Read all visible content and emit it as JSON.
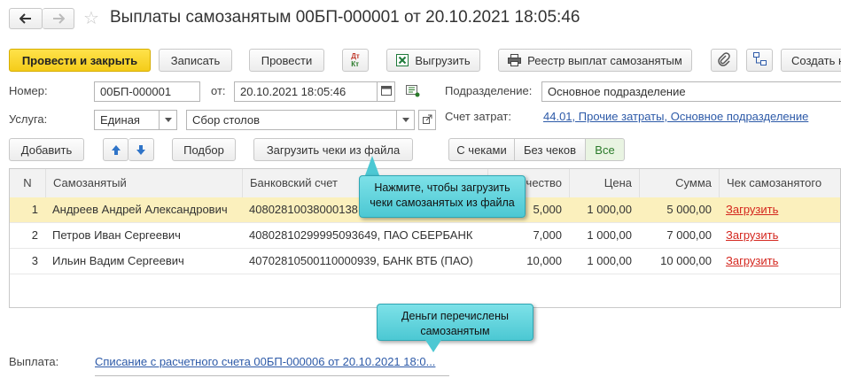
{
  "window": {
    "title": "Выплаты самозанятым 00БП-000001 от 20.10.2021 18:05:46"
  },
  "toolbar": {
    "post_close": "Провести и закрыть",
    "save": "Записать",
    "post": "Провести",
    "dt_kt_top": "Дт",
    "dt_kt_bottom": "Кт",
    "export": "Выгрузить",
    "registry": "Реестр выплат самозанятым",
    "create_on_basis": "Создать н"
  },
  "form": {
    "number_label": "Номер:",
    "number_value": "00БП-000001",
    "date_label": "от:",
    "date_value": "20.10.2021 18:05:46",
    "division_label": "Подразделение:",
    "division_value": "Основное подразделение",
    "service_label": "Услуга:",
    "service_type": "Единая",
    "service_value": "Сбор столов",
    "cost_account_label": "Счет затрат:",
    "cost_account_value": "44.01, Прочие затраты, Основное подразделение"
  },
  "table_toolbar": {
    "add": "Добавить",
    "pick": "Подбор",
    "load_receipts": "Загрузить чеки из файла",
    "filters": [
      "С чеками",
      "Без чеков",
      "Все"
    ],
    "active_filter": "Все"
  },
  "table": {
    "headers": [
      "N",
      "Самозанятый",
      "Банковский счет",
      "Количество",
      "Цена",
      "Сумма",
      "Чек самозанятого"
    ],
    "header_qty_visible": "чество",
    "rows": [
      {
        "n": "1",
        "person": "Андреев Андрей Александрович",
        "account": "40802810038000138",
        "qty": "5,000",
        "price": "1 000,00",
        "sum": "5 000,00",
        "receipt": "Загрузить"
      },
      {
        "n": "2",
        "person": "Петров Иван Сергеевич",
        "account": "40802810299995093649, ПАО СБЕРБАНК",
        "qty": "7,000",
        "price": "1 000,00",
        "sum": "7 000,00",
        "receipt": "Загрузить"
      },
      {
        "n": "3",
        "person": "Ильин Вадим Сергеевич",
        "account": "40702810500110000939, БАНК ВТБ (ПАО)",
        "qty": "10,000",
        "price": "1 000,00",
        "sum": "10 000,00",
        "receipt": "Загрузить"
      }
    ],
    "selected_row": 0
  },
  "tooltips": {
    "load_hint": "Нажмите, чтобы загрузить чеки самозанятых из файла",
    "paid_hint": "Деньги перечислены самозанятым"
  },
  "footer": {
    "payment_label": "Выплата:",
    "payment_value": "Списание с расчетного счета 00БП-000006 от 20.10.2021 18:0..."
  },
  "colors": {
    "primary_button": "#f4cc1a",
    "selected_row": "#fbf0bd",
    "link": "#2d5aa8",
    "red_link": "#d4261e",
    "tooltip": "#4cc8d3"
  }
}
